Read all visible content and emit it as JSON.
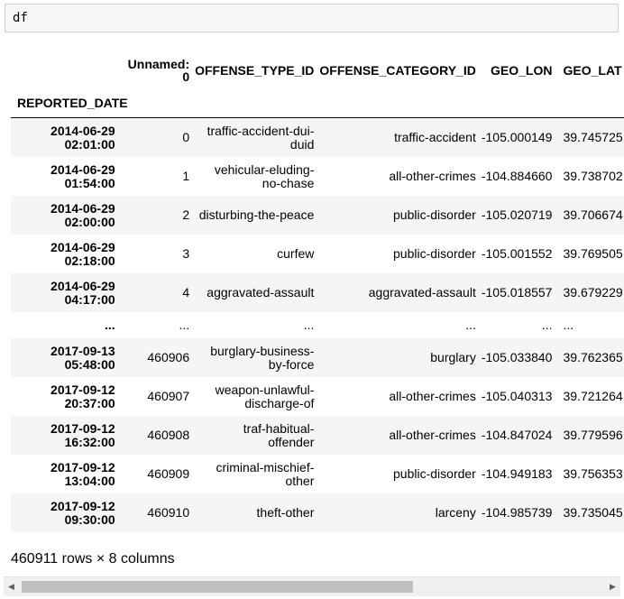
{
  "input": {
    "code": "df"
  },
  "table": {
    "header_row1": [
      "",
      "Unnamed: 0",
      "OFFENSE_TYPE_ID",
      "OFFENSE_CATEGORY_ID",
      "GEO_LON",
      "GEO_LAT"
    ],
    "index_name": "REPORTED_DATE",
    "rows": [
      {
        "index": [
          "2014-06-29",
          "02:01:00"
        ],
        "cells": [
          "0",
          "traffic-accident-dui-duid",
          "traffic-accident",
          "-105.000149",
          "39.745725"
        ]
      },
      {
        "index": [
          "2014-06-29",
          "01:54:00"
        ],
        "cells": [
          "1",
          "vehicular-eluding-no-chase",
          "all-other-crimes",
          "-104.884660",
          "39.738702"
        ]
      },
      {
        "index": [
          "2014-06-29",
          "02:00:00"
        ],
        "cells": [
          "2",
          "disturbing-the-peace",
          "public-disorder",
          "-105.020719",
          "39.706674"
        ]
      },
      {
        "index": [
          "2014-06-29",
          "02:18:00"
        ],
        "cells": [
          "3",
          "curfew",
          "public-disorder",
          "-105.001552",
          "39.769505"
        ]
      },
      {
        "index": [
          "2014-06-29",
          "04:17:00"
        ],
        "cells": [
          "4",
          "aggravated-assault",
          "aggravated-assault",
          "-105.018557",
          "39.679229"
        ]
      },
      {
        "ellipsis": true,
        "index": [
          "..."
        ],
        "cells": [
          "...",
          "...",
          "...",
          "...",
          "..."
        ]
      },
      {
        "index": [
          "2017-09-13",
          "05:48:00"
        ],
        "cells": [
          "460906",
          "burglary-business-by-force",
          "burglary",
          "-105.033840",
          "39.762365"
        ]
      },
      {
        "index": [
          "2017-09-12",
          "20:37:00"
        ],
        "cells": [
          "460907",
          "weapon-unlawful-discharge-of",
          "all-other-crimes",
          "-105.040313",
          "39.721264"
        ]
      },
      {
        "index": [
          "2017-09-12",
          "16:32:00"
        ],
        "cells": [
          "460908",
          "traf-habitual-offender",
          "all-other-crimes",
          "-104.847024",
          "39.779596"
        ]
      },
      {
        "index": [
          "2017-09-12",
          "13:04:00"
        ],
        "cells": [
          "460909",
          "criminal-mischief-other",
          "public-disorder",
          "-104.949183",
          "39.756353"
        ]
      },
      {
        "index": [
          "2017-09-12",
          "09:30:00"
        ],
        "cells": [
          "460910",
          "theft-other",
          "larceny",
          "-104.985739",
          "39.735045"
        ]
      }
    ]
  },
  "shape": "460911 rows × 8 columns",
  "scrollbar": {
    "left_icon": "scroll-left-arrow",
    "right_icon": "scroll-right-arrow"
  }
}
